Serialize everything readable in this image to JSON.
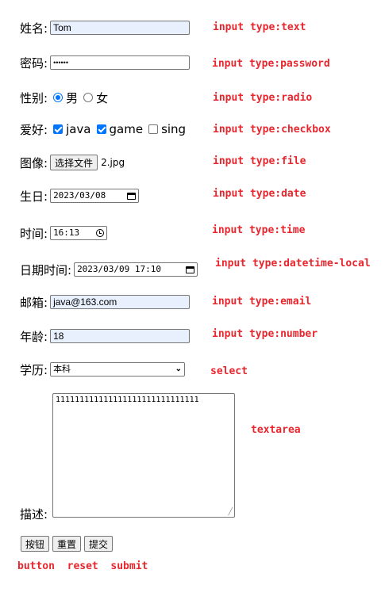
{
  "name": {
    "label": "姓名:",
    "value": "Tom",
    "note": "input type:text"
  },
  "password": {
    "label": "密码:",
    "value": "••••••",
    "note": "input type:password"
  },
  "gender": {
    "label": "性别:",
    "options": [
      "男",
      "女"
    ],
    "selected": "男",
    "note": "input type:radio"
  },
  "hobby": {
    "label": "爱好:",
    "options": [
      {
        "label": "java",
        "checked": true
      },
      {
        "label": "game",
        "checked": true
      },
      {
        "label": "sing",
        "checked": false
      }
    ],
    "note": "input type:checkbox"
  },
  "image": {
    "label": "图像:",
    "button": "选择文件",
    "filename": "2.jpg",
    "note": "input type:file"
  },
  "birthday": {
    "label": "生日:",
    "value": "2023/03/08",
    "icon": "calendar-icon",
    "note": "input type:date"
  },
  "time": {
    "label": "时间:",
    "value": "16:13",
    "icon": "clock-icon",
    "note": "input type:time"
  },
  "datetime": {
    "label": "日期时间:",
    "value": "2023/03/09 17:10",
    "icon": "calendar-icon",
    "note": "input type:datetime-local"
  },
  "email": {
    "label": "邮箱:",
    "value": "java@163.com",
    "note": "input type:email"
  },
  "age": {
    "label": "年龄:",
    "value": "18",
    "note": "input type:number"
  },
  "education": {
    "label": "学历:",
    "value": "本科",
    "note": "select"
  },
  "description": {
    "label": "描述:",
    "value": "111111111111111111111111111111",
    "note": "textarea"
  },
  "buttons": {
    "button": "按钮",
    "reset": "重置",
    "submit": "提交",
    "note": "button  reset  submit"
  },
  "colors": {
    "note": "#e8262e",
    "accent": "#0075ff",
    "autofill": "#e8f0fe"
  }
}
